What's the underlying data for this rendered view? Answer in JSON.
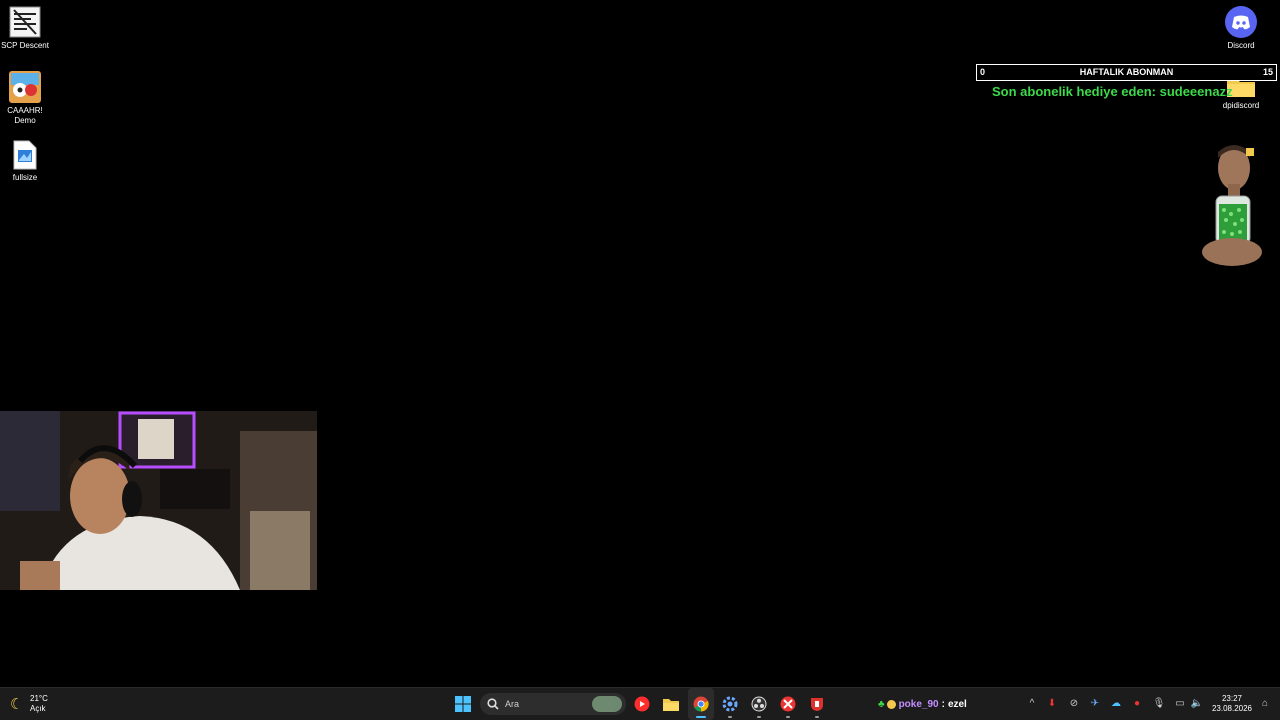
{
  "desktop": {
    "icons": [
      {
        "label": "SCP Descent",
        "icon": "scp-descent-icon"
      },
      {
        "label": "CAAAHR! Demo",
        "icon": "game-demo-icon"
      },
      {
        "label": "fullsize",
        "icon": "image-file-icon"
      },
      {
        "label": "Discord",
        "icon": "discord-icon"
      },
      {
        "label": "dpidiscord",
        "icon": "folder-icon"
      }
    ]
  },
  "overlay": {
    "sub_goal": {
      "title": "HAFTALIK ABONMAN",
      "current": "0",
      "target": "15"
    },
    "last_gift": "Son abonelik hediye eden: sudeeenazz"
  },
  "taskbar": {
    "weather": {
      "temp": "21°C",
      "condition": "Açık",
      "icon": "moon-icon"
    },
    "search_placeholder": "Ara",
    "apps": [
      "windows-start-icon",
      "search-icon",
      "youtube-music-icon",
      "file-explorer-icon",
      "chrome-icon",
      "settings-icon",
      "obs-icon",
      "app-red-icon",
      "app-shield-icon"
    ],
    "chat": {
      "user": "poke_90",
      "message": "ezel"
    },
    "clock": {
      "time": "23:27",
      "date": "23.08.2026"
    }
  },
  "colors": {
    "accent_green": "#3dd94a",
    "taskbar": "#1c1c1c",
    "discord": "#5865f2",
    "chat_user": "#c38fff"
  }
}
